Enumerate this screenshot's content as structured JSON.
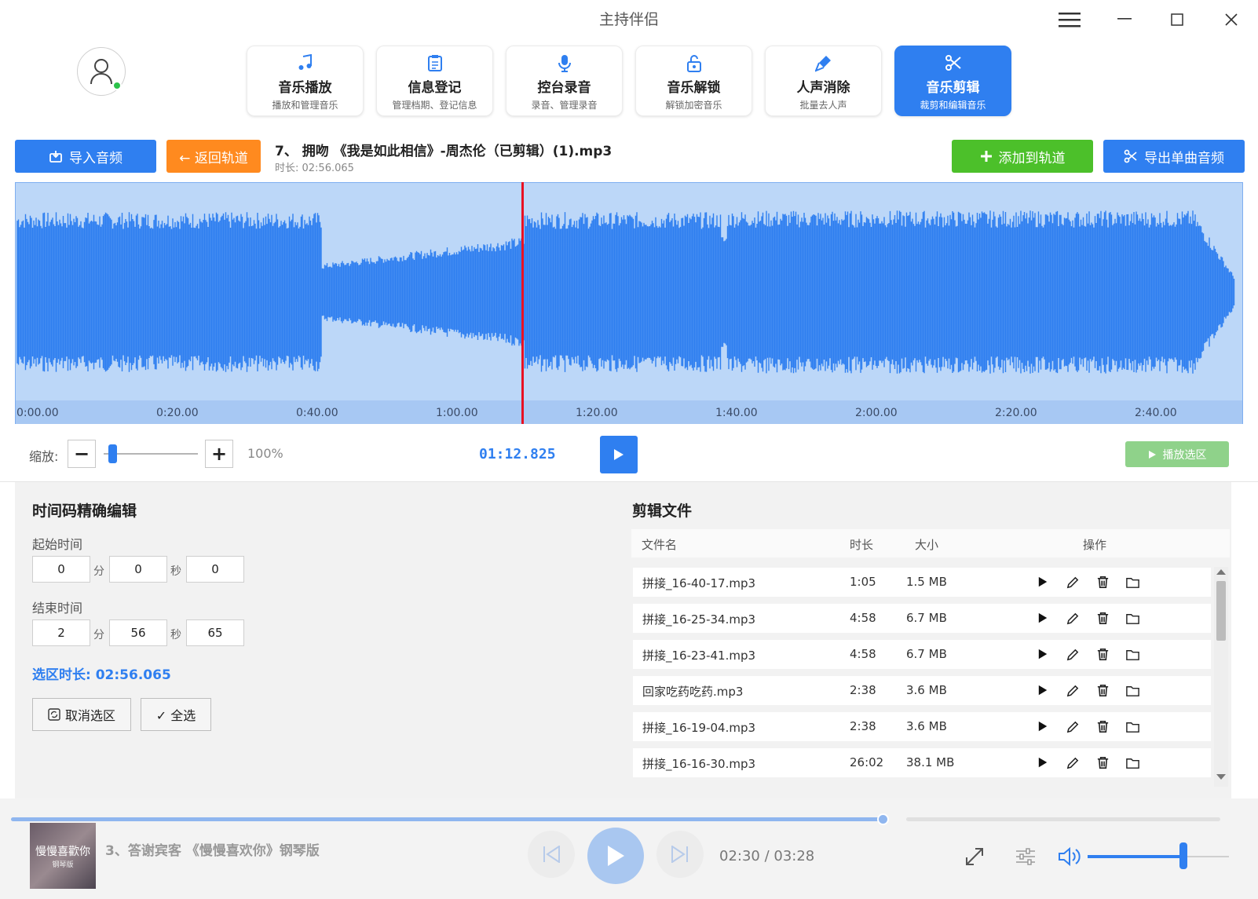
{
  "window": {
    "title": "主持伴侣"
  },
  "tabs": [
    {
      "label": "音乐播放",
      "sub": "播放和管理音乐",
      "icon": "music-note-icon"
    },
    {
      "label": "信息登记",
      "sub": "管理档期、登记信息",
      "icon": "clipboard-icon"
    },
    {
      "label": "控台录音",
      "sub": "录音、管理录音",
      "icon": "microphone-icon"
    },
    {
      "label": "音乐解锁",
      "sub": "解锁加密音乐",
      "icon": "unlock-icon"
    },
    {
      "label": "人声消除",
      "sub": "批量去人声",
      "icon": "mic-mute-icon"
    },
    {
      "label": "音乐剪辑",
      "sub": "裁剪和编辑音乐",
      "icon": "scissors-icon",
      "active": true
    }
  ],
  "toolbar": {
    "import_label": "导入音频",
    "back_label": "← 返回轨道",
    "add_label": "添加到轨道",
    "export_label": "导出单曲音频"
  },
  "file": {
    "title": "7、 拥吻 《我是如此相信》-周杰伦（已剪辑）(1).mp3",
    "duration": "时长: 02:56.065"
  },
  "timeline": {
    "ticks": [
      "0:00.00",
      "0:20.00",
      "0:40.00",
      "1:00.00",
      "1:20.00",
      "1:40.00",
      "2:00.00",
      "2:20.00",
      "2:40.00"
    ],
    "playhead_seconds": 72.825
  },
  "zoom": {
    "label": "缩放:",
    "value": "100%",
    "current_time": "01:12.825",
    "play_selection": "播放选区"
  },
  "timecode": {
    "title": "时间码精确编辑",
    "start_label": "起始时间",
    "end_label": "结束时间",
    "start": {
      "min": "0",
      "sec": "0",
      "ms": "0"
    },
    "end": {
      "min": "2",
      "sec": "56",
      "ms": "65"
    },
    "unit_min": "分",
    "unit_sec": "秒",
    "selection": "选区时长: 02:56.065",
    "cancel_label": "取消选区",
    "all_label": "✓ 全选"
  },
  "clips": {
    "title": "剪辑文件",
    "headers": {
      "name": "文件名",
      "duration": "时长",
      "size": "大小",
      "ops": "操作"
    },
    "rows": [
      {
        "name": "拼接_16-40-17.mp3",
        "duration": "1:05",
        "size": "1.5 MB"
      },
      {
        "name": "拼接_16-25-34.mp3",
        "duration": "4:58",
        "size": "6.7 MB"
      },
      {
        "name": "拼接_16-23-41.mp3",
        "duration": "4:58",
        "size": "6.7 MB"
      },
      {
        "name": "回家吃药吃药.mp3",
        "duration": "2:38",
        "size": "3.6 MB"
      },
      {
        "name": "拼接_16-19-04.mp3",
        "duration": "2:38",
        "size": "3.6 MB"
      },
      {
        "name": "拼接_16-16-30.mp3",
        "duration": "26:02",
        "size": "38.1 MB"
      }
    ]
  },
  "player": {
    "track": "3、答谢宾客 《慢慢喜欢你》钢琴版",
    "album_text": "慢慢喜歡你",
    "album_sub": "钢琴版",
    "time": "02:30 / 03:28",
    "progress": 0.721,
    "volume": 0.68
  },
  "colors": {
    "accent": "#2f7ff0",
    "orange": "#ff8a1f",
    "green": "#4cc02a",
    "playhead": "#e81123",
    "wave": "#2f7ff0"
  }
}
